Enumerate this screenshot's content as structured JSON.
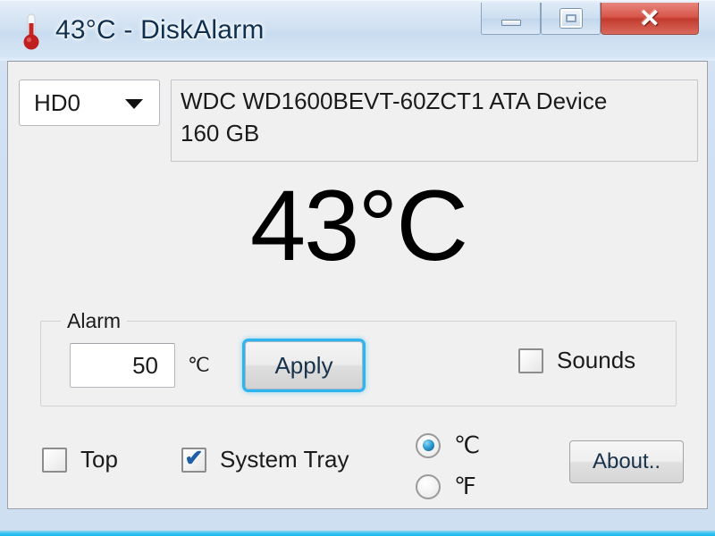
{
  "window": {
    "title": "43°C - DiskAlarm",
    "icon": "thermometer-icon",
    "controls": {
      "minimize_label": "",
      "maximize_label": "",
      "close_label": "✕"
    }
  },
  "drive_selector": {
    "selected": "HD0",
    "options": [
      "HD0"
    ],
    "arrow_icon": "chevron-down-icon"
  },
  "device_info": {
    "model": "WDC WD1600BEVT-60ZCT1 ATA Device",
    "capacity": "160 GB"
  },
  "temperature": {
    "display": "43°C",
    "value": 43,
    "unit": "°C"
  },
  "alarm": {
    "legend": "Alarm",
    "threshold_value": "50",
    "threshold_placeholder": "50",
    "unit_label": "℃",
    "apply_label": "Apply",
    "sounds": {
      "label": "Sounds",
      "checked": false,
      "mark": ""
    }
  },
  "options": {
    "top": {
      "label": "Top",
      "checked": false,
      "mark": ""
    },
    "system_tray": {
      "label": "System Tray",
      "checked": true,
      "mark": "✔"
    },
    "units": {
      "celsius": {
        "label": "℃",
        "selected": true
      },
      "fahrenheit": {
        "label": "℉",
        "selected": false
      }
    },
    "about_label": "About.."
  },
  "colors": {
    "accent_focus": "#2eb4ee",
    "close_button": "#c23b2e",
    "client_background": "#f0f0f0",
    "titlebar": "#cfe0f1",
    "check_mark": "#1f5fa8",
    "radio_dot": "#2f9fd6"
  }
}
